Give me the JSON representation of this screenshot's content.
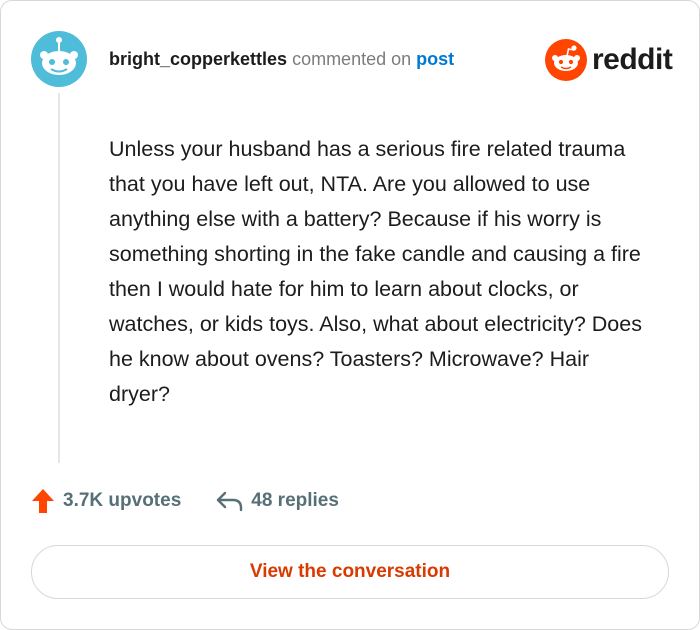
{
  "comment": {
    "username": "bright_copperkettles",
    "action_text": "commented on",
    "post_link_text": "post",
    "body": "Unless your husband has a serious fire related trauma that you have left out, NTA. Are you allowed to use anything else with a battery? Because if his worry is something shorting in the fake candle and causing a fire then I would hate for him to learn about clocks, or watches, or kids toys. Also, what about electricity? Does he know about ovens? Toasters? Microwave? Hair dryer?"
  },
  "brand": {
    "wordmark": "reddit",
    "accent_color": "#ff4500"
  },
  "stats": {
    "upvotes_label": "3.7K upvotes",
    "replies_label": "48 replies"
  },
  "actions": {
    "view_conversation_label": "View the conversation"
  },
  "icons": {
    "avatar": "snoo-avatar-icon",
    "logo": "reddit-snoo-logo-icon",
    "upvote": "upvote-arrow-icon",
    "reply": "reply-arrow-icon"
  },
  "colors": {
    "username": "#1c1c1c",
    "link": "#0079d3",
    "button_text": "#d93a00",
    "upvote_arrow": "#ff4500",
    "muted": "#576f76"
  }
}
